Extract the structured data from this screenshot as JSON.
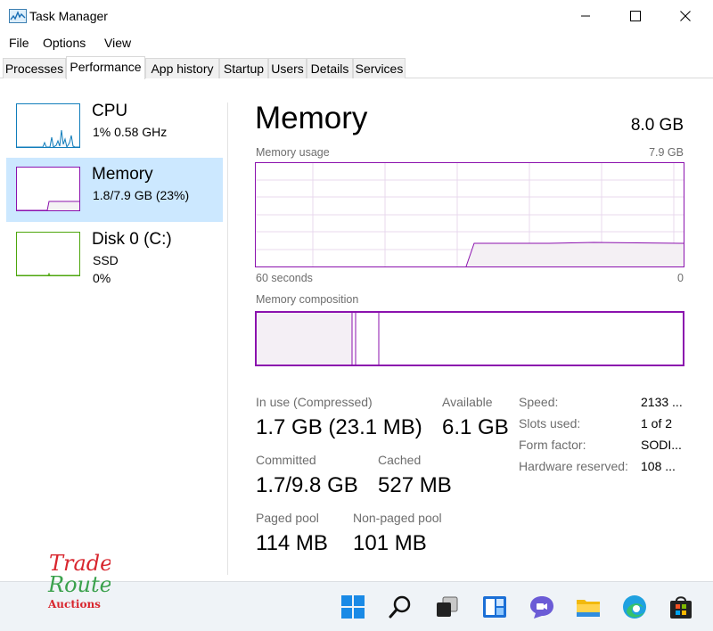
{
  "window": {
    "title": "Task Manager",
    "minimize_icon": "minimize-icon",
    "maximize_icon": "maximize-icon",
    "close_icon": "close-icon"
  },
  "menu": [
    "File",
    "Options",
    "View"
  ],
  "tabs": [
    {
      "label": "Processes",
      "active": false
    },
    {
      "label": "Performance",
      "active": true
    },
    {
      "label": "App history",
      "active": false
    },
    {
      "label": "Startup",
      "active": false
    },
    {
      "label": "Users",
      "active": false
    },
    {
      "label": "Details",
      "active": false
    },
    {
      "label": "Services",
      "active": false
    }
  ],
  "resources": [
    {
      "name": "CPU",
      "detail1": "1%  0.58 GHz",
      "detail2": "",
      "color": "#117dbb",
      "selected": false
    },
    {
      "name": "Memory",
      "detail1": "1.8/7.9 GB (23%)",
      "detail2": "",
      "color": "#8b12ae",
      "selected": true
    },
    {
      "name": "Disk 0 (C:)",
      "detail1": "SSD",
      "detail2": "0%",
      "color": "#4da60c",
      "selected": false
    }
  ],
  "memory": {
    "title": "Memory",
    "total": "8.0 GB",
    "usage_label": "Memory usage",
    "usage_max": "7.9 GB",
    "time_label": "60 seconds",
    "time_end": "0",
    "composition_label": "Memory composition",
    "usage_fraction": 0.23,
    "stats": {
      "in_use_label": "In use (Compressed)",
      "in_use_value": "1.7 GB (23.1 MB)",
      "available_label": "Available",
      "available_value": "6.1 GB",
      "committed_label": "Committed",
      "committed_value": "1.7/9.8 GB",
      "cached_label": "Cached",
      "cached_value": "527 MB",
      "paged_label": "Paged pool",
      "paged_value": "114 MB",
      "nonpaged_label": "Non-paged pool",
      "nonpaged_value": "101 MB"
    },
    "specs": [
      {
        "label": "Speed:",
        "value": "2133 ..."
      },
      {
        "label": "Slots used:",
        "value": "1 of 2"
      },
      {
        "label": "Form factor:",
        "value": "SODI..."
      },
      {
        "label": "Hardware reserved:",
        "value": "108 ..."
      }
    ]
  },
  "taskbar": {
    "icons": [
      "start-icon",
      "search-icon",
      "task-view-icon",
      "widgets-icon",
      "chat-icon",
      "file-explorer-icon",
      "edge-icon",
      "store-icon"
    ]
  },
  "watermark": {
    "line1": "Trade",
    "line2": "Route",
    "line3": "Auctions"
  },
  "colors": {
    "memory_accent": "#8b12ae",
    "selection": "#cce8ff",
    "cpu_accent": "#117dbb",
    "disk_accent": "#4da60c"
  }
}
